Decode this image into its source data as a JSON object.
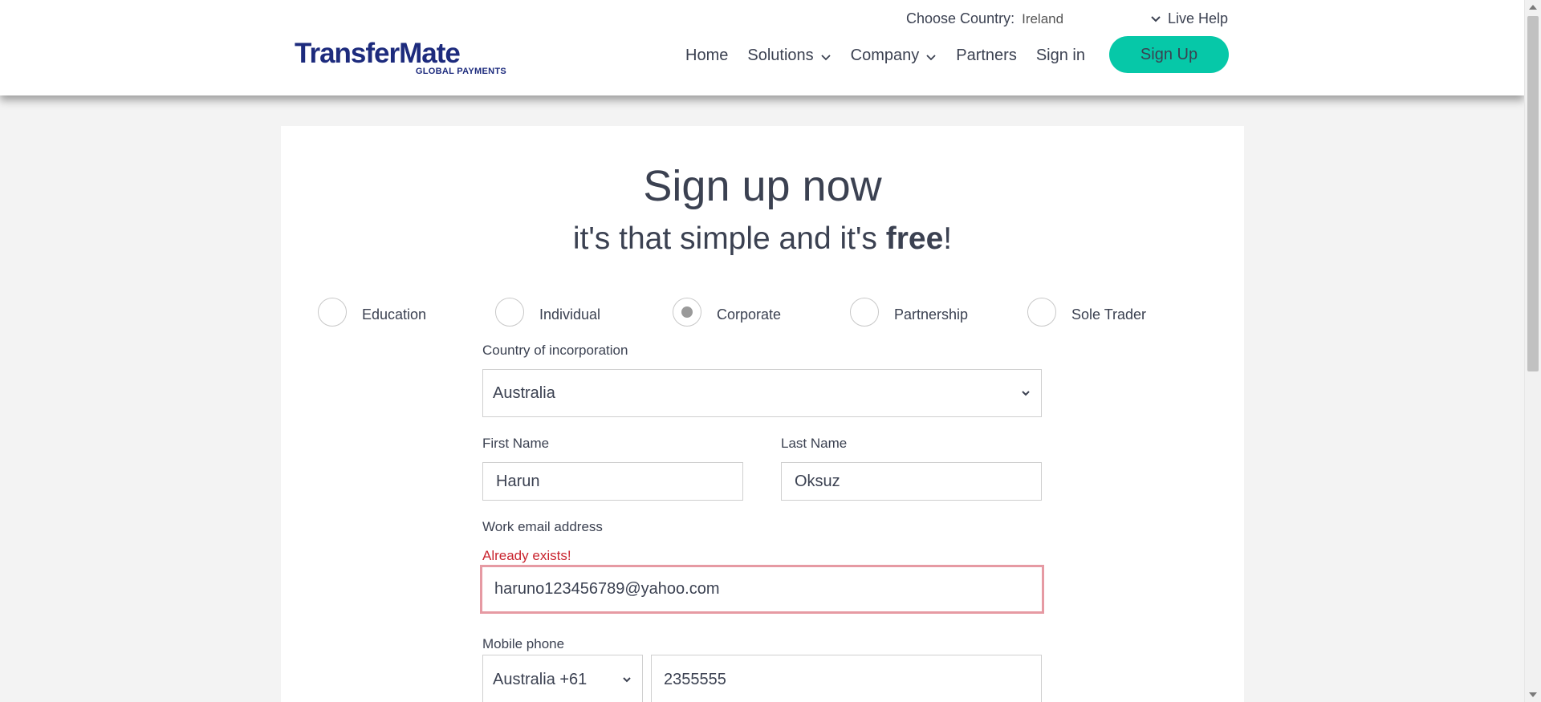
{
  "header": {
    "choose_country_label": "Choose Country:",
    "choose_country_value": "Ireland",
    "live_help": "Live Help",
    "logo_brand": "TransferMate",
    "logo_tagline": "GLOBAL PAYMENTS",
    "nav": [
      {
        "label": "Home"
      },
      {
        "label": "Solutions"
      },
      {
        "label": "Company"
      },
      {
        "label": "Partners"
      },
      {
        "label": "Sign in"
      }
    ],
    "signup_button": "Sign Up"
  },
  "form": {
    "title": "Sign up now",
    "subtitle_part1": "it's that simple and it's ",
    "subtitle_bold": "free",
    "subtitle_end": "!",
    "account_types": [
      {
        "label": "Education",
        "selected": false
      },
      {
        "label": "Individual",
        "selected": false
      },
      {
        "label": "Corporate",
        "selected": true
      },
      {
        "label": "Partnership",
        "selected": false
      },
      {
        "label": "Sole Trader",
        "selected": false
      }
    ],
    "country_label": "Country of incorporation",
    "country_value": "Australia",
    "first_name_label": "First Name",
    "first_name_value": "Harun",
    "last_name_label": "Last Name",
    "last_name_value": "Oksuz",
    "email_label": "Work email address",
    "email_error": "Already exists!",
    "email_value": "haruno123456789@yahoo.com",
    "mobile_label": "Mobile phone",
    "mobile_code_value": "Australia +61",
    "mobile_number_value": "2355555"
  },
  "colors": {
    "brand_navy": "#1d2b7d",
    "accent_teal": "#06c8a8",
    "error_red": "#c9242e",
    "error_border": "#e69aa3",
    "text": "#3b4151"
  }
}
